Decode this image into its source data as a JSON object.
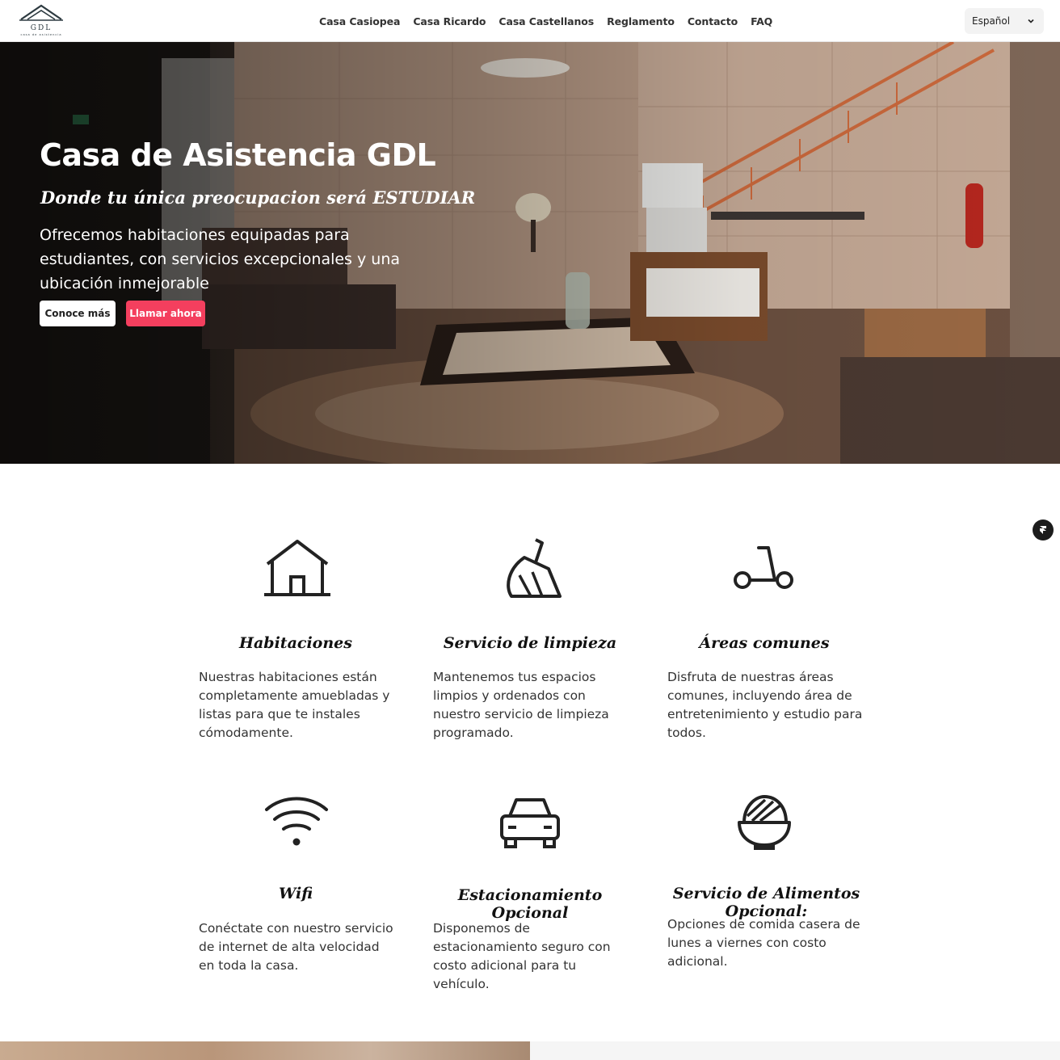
{
  "nav": {
    "logo_text": "GDL",
    "logo_tagline": "casa de asistencia",
    "items": [
      {
        "label": "Casa Casiopea"
      },
      {
        "label": "Casa Ricardo"
      },
      {
        "label": "Casa Castellanos"
      },
      {
        "label": "Reglamento"
      },
      {
        "label": "Contacto"
      },
      {
        "label": "FAQ"
      }
    ],
    "language": {
      "selected": "Español",
      "icon": "chevron-down-icon"
    }
  },
  "hero": {
    "title": "Casa de Asistencia GDL",
    "subtitle": "Donde tu única preocupacion será ESTUDIAR",
    "description": "Ofrecemos habitaciones equipadas para estudiantes, con servicios excepcionales y una ubicación inmejorable",
    "primary_button": "Conoce más",
    "secondary_button": "Llamar ahora",
    "accent_color": "#f43f5e"
  },
  "features": [
    {
      "icon": "house-icon",
      "title": "Habitaciones",
      "text": "Nuestras habitaciones están completamente amuebladas y listas para que te instales cómodamente."
    },
    {
      "icon": "broom-icon",
      "title": "Servicio de limpieza",
      "text": "Mantenemos tus espacios limpios y ordenados con nuestro servicio de limpieza programado."
    },
    {
      "icon": "scooter-icon",
      "title": "Áreas comunes",
      "text": "Disfruta de nuestras áreas comunes, incluyendo área de entretenimiento y estudio para todos."
    },
    {
      "icon": "wifi-icon",
      "title": "Wifi",
      "text": "Conéctate con nuestro servicio de internet de alta velocidad en toda la casa."
    },
    {
      "icon": "car-icon",
      "title": "Estacionamiento Opcional",
      "text": "Disponemos de estacionamiento seguro con costo adicional para tu vehículo."
    },
    {
      "icon": "food-bowl-icon",
      "title": "Servicio de Alimentos Opcional:",
      "text": "Opciones de comida casera de lunes a viernes con costo adicional."
    }
  ],
  "floating_button": {
    "icon": "framer-icon"
  }
}
